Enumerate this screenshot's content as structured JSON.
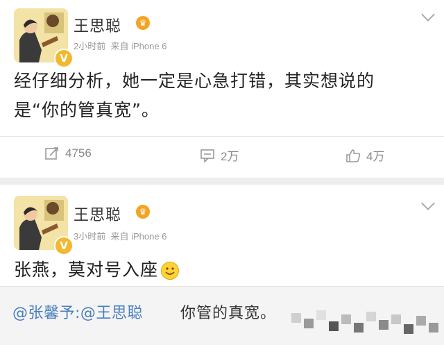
{
  "post1": {
    "username": "王思聪",
    "time": "2小时前",
    "source": "来自 iPhone 6",
    "text_line1": "经仔细分析，她一定是心急打错，其实想说的",
    "text_line2": "是“你的管真宽”。",
    "repost_count": "4756",
    "comment_count": "2万",
    "like_count": "4万"
  },
  "post2": {
    "username": "王思聪",
    "time": "3小时前",
    "source": "来自 iPhone 6",
    "text": "张燕，莫对号入座"
  },
  "repost": {
    "users": "@张馨予:@王思聪",
    "text": "你管的真宽。"
  },
  "colors": {
    "link": "#4a7fbf",
    "verified_badge": "#f2b830",
    "muted": "#999999"
  },
  "icons": [
    "chevron-down-icon",
    "repost-icon",
    "comment-icon",
    "like-icon",
    "verified-icon",
    "crown-icon",
    "smiley-icon"
  ]
}
